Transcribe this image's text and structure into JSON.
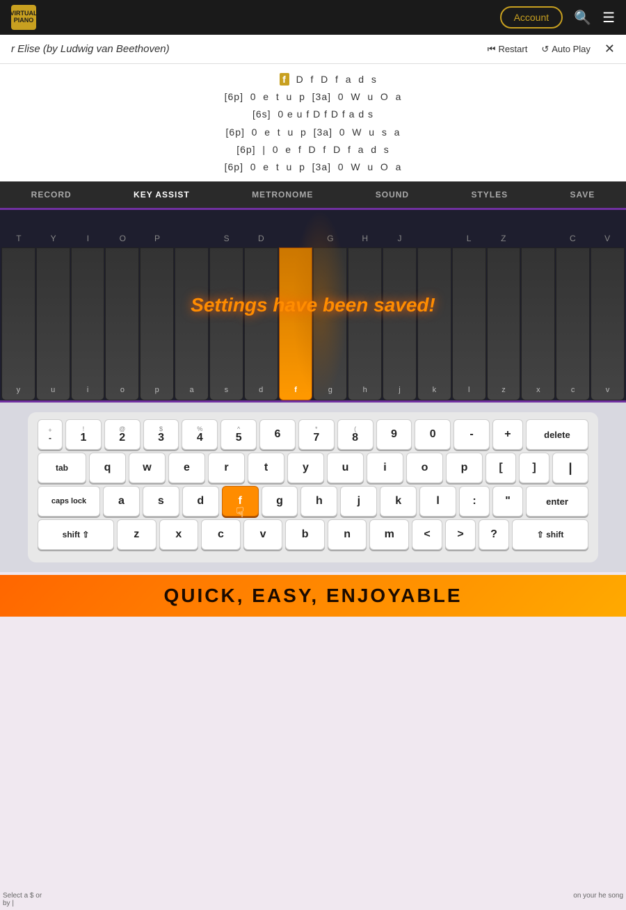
{
  "header": {
    "logo_line1": "VIRTUAL",
    "logo_line2": "PIANO",
    "account_label": "Account",
    "search_icon": "🔍",
    "menu_icon": "☰"
  },
  "song_bar": {
    "title": "r Elise (by Ludwig van Beethoven)",
    "restart_label": "Restart",
    "autoplay_label": "Auto Play",
    "close_icon": "✕"
  },
  "sheet": {
    "lines": [
      "f  D  f  D  f  a  d  s",
      "[6p]  0  e  t  u  p  [3a]  0  W  u  O  a",
      "[6s]  0 e u f D f D f a d s",
      "[6p]  0  e  t  u  p  [3a]  0  W  u  s  a",
      "[6p]  |  0  e  f  D  f  D  f  a  d  s",
      "[6p]  0  e  t  u  p  [3a]  0  W  u  O  a"
    ]
  },
  "toolbar": {
    "items": [
      "RECORD",
      "KEY ASSIST",
      "METRONOME",
      "SOUND",
      "STYLES",
      "SAVE"
    ]
  },
  "piano": {
    "message": "Settings have been saved!",
    "white_keys": [
      "T",
      "Y",
      "I",
      "O",
      "P",
      "S",
      "D",
      "G",
      "H",
      "J",
      "L",
      "Z",
      "C",
      "V"
    ],
    "white_keys_bottom": [
      "y",
      "u",
      "i",
      "o",
      "p",
      "a",
      "s",
      "d",
      "f",
      "g",
      "h",
      "j",
      "k",
      "l",
      "z",
      "x",
      "c",
      "v"
    ]
  },
  "keyboard": {
    "row1": [
      {
        "top": "!",
        "main": "1"
      },
      {
        "top": "@",
        "main": "2"
      },
      {
        "top": "$",
        "main": "3"
      },
      {
        "top": "%",
        "main": "4"
      },
      {
        "top": "^",
        "main": "5"
      },
      {
        "top": "",
        "main": "6"
      },
      {
        "top": "*",
        "main": "7"
      },
      {
        "top": "(",
        "main": "8"
      },
      {
        "top": "",
        "main": "9"
      },
      {
        "top": "",
        "main": "0"
      }
    ],
    "row_qwerty": [
      "q",
      "w",
      "e",
      "r",
      "t",
      "y",
      "u",
      "i",
      "o",
      "p"
    ],
    "row_asdf": [
      "a",
      "s",
      "d",
      "f",
      "g",
      "h",
      "j",
      "k",
      "l"
    ],
    "row_zxcv": [
      "z",
      "x",
      "c",
      "v",
      "b",
      "n",
      "m"
    ],
    "special": {
      "tab": "tab",
      "caps": "caps lock",
      "shift_l": "shift ⇧",
      "shift_r": "⇧ shift",
      "delete": "delete",
      "enter": "enter",
      "plus_minus_top": "+",
      "plus_minus_bot": "-",
      "plus2_top": "+",
      "minus2": "-",
      "bracket_l": "[",
      "bracket_r": "]",
      "pipe": "|",
      "colon": ":",
      "quote": "\"",
      "lt": "<",
      "gt": ">",
      "question": "?"
    }
  },
  "side_left": "Select a $ or by |",
  "side_right": "on your he song",
  "bottom_banner": "QUICK, EASY, ENJOYABLE"
}
